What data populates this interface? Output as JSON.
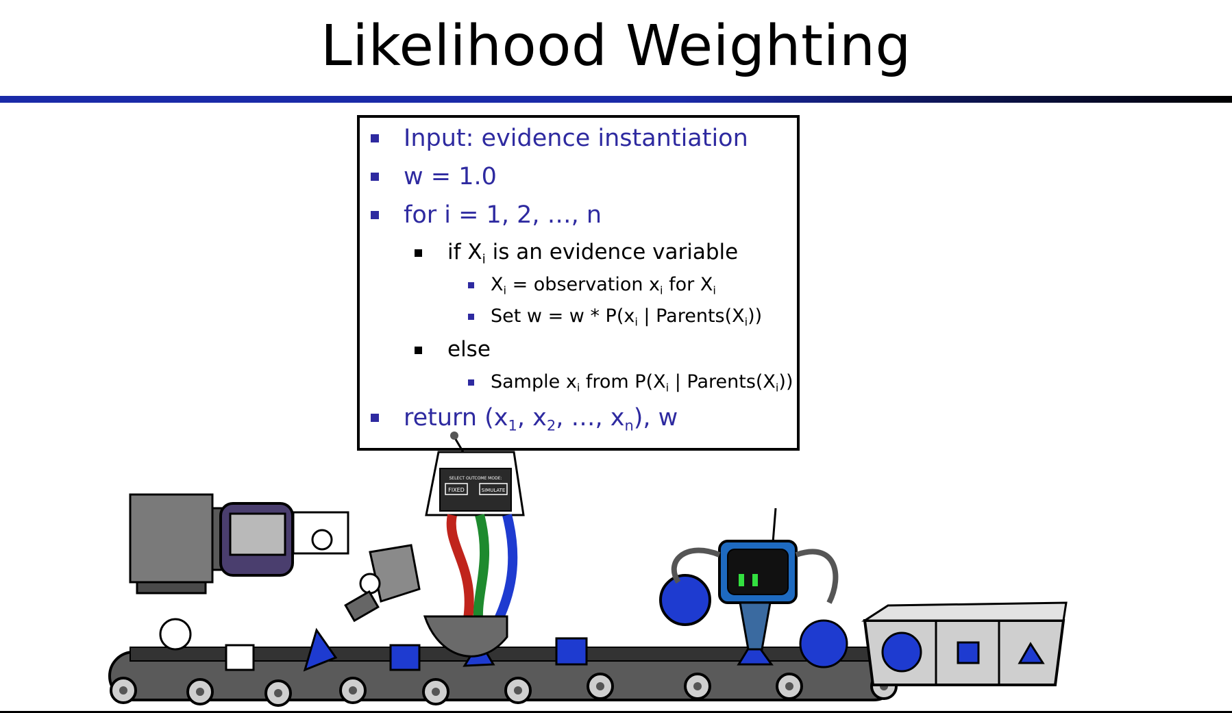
{
  "title": "Likelihood Weighting",
  "colors": {
    "accent": "#2e2aa0",
    "rule_blue": "#1a2aa8",
    "robot_blue": "#1e3bd0",
    "machine_gray": "#8a8a8a"
  },
  "algorithm": {
    "input": "Input: evidence instantiation",
    "init": "w = 1.0",
    "loop": "for i = 1, 2, …, n",
    "if_pre": "if X",
    "if_sub": "i",
    "if_post": " is an evidence variable",
    "assign_a": "X",
    "assign_b": "i",
    "assign_c": " = observation x",
    "assign_d": "i",
    "assign_e": " for X",
    "assign_f": "i",
    "set_a": "Set w = w * P(x",
    "set_b": "i",
    "set_c": " | Parents(X",
    "set_d": "i",
    "set_e": "))",
    "else": "else",
    "sample_a": "Sample x",
    "sample_b": "i",
    "sample_c": " from P(X",
    "sample_d": "i",
    "sample_e": " | Parents(X",
    "sample_f": "i",
    "sample_g": "))",
    "ret_a": "return (x",
    "ret_b": "1",
    "ret_c": ", x",
    "ret_d": "2",
    "ret_e": ", …, x",
    "ret_f": "n",
    "ret_g": "), w"
  },
  "illustration": {
    "panel_caption": "SELECT OUTCOME MODE:",
    "button_fixed": "FIXED",
    "button_simulate": "SIMULATE"
  }
}
